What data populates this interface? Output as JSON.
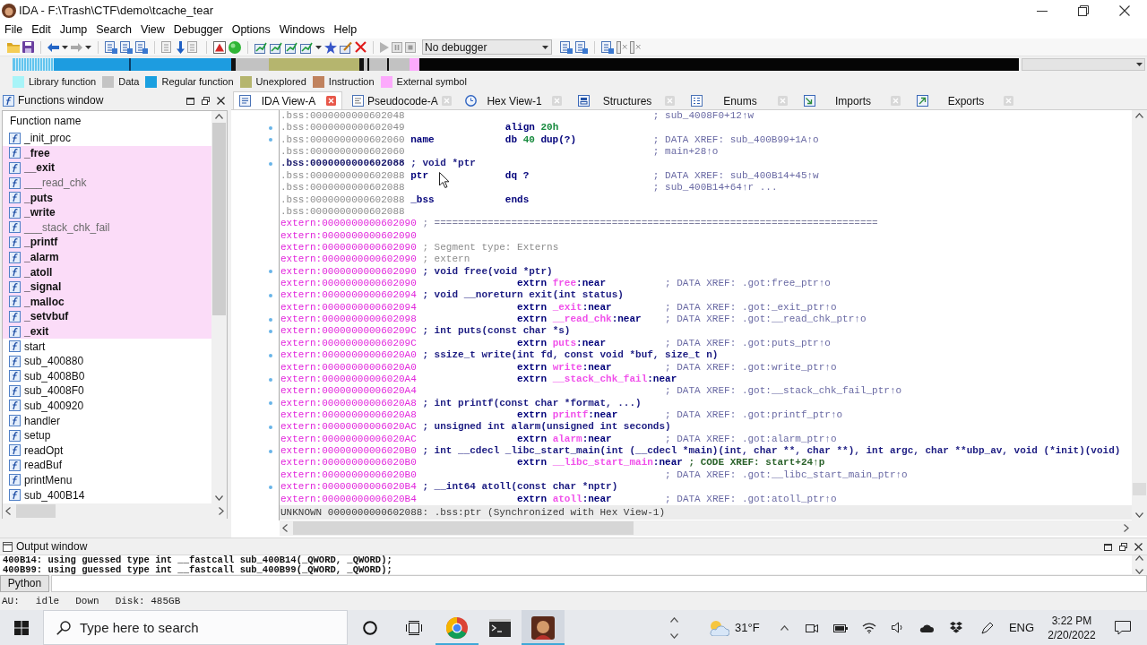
{
  "window": {
    "title": "IDA - F:\\Trash\\CTF\\demo\\tcache_tear"
  },
  "menu": [
    "File",
    "Edit",
    "Jump",
    "Search",
    "View",
    "Debugger",
    "Options",
    "Windows",
    "Help"
  ],
  "toolbar": {
    "debugger": "No debugger"
  },
  "legend": [
    {
      "label": "Library function",
      "color": "#a8f4f8"
    },
    {
      "label": "Data",
      "color": "#c4c4c4"
    },
    {
      "label": "Regular function",
      "color": "#1aa0e0"
    },
    {
      "label": "Unexplored",
      "color": "#b5b56e"
    },
    {
      "label": "Instruction",
      "color": "#c0825e"
    },
    {
      "label": "External symbol",
      "color": "#fcaafc"
    }
  ],
  "functions_window": {
    "title": "Functions window",
    "column": "Function name",
    "items": [
      {
        "name": "_init_proc",
        "external": false,
        "dimmed": false
      },
      {
        "name": "_free",
        "external": true,
        "dimmed": false
      },
      {
        "name": "__exit",
        "external": true,
        "dimmed": false
      },
      {
        "name": "___read_chk",
        "external": true,
        "dimmed": true
      },
      {
        "name": "_puts",
        "external": true,
        "dimmed": false
      },
      {
        "name": "_write",
        "external": true,
        "dimmed": false
      },
      {
        "name": "___stack_chk_fail",
        "external": true,
        "dimmed": true
      },
      {
        "name": "_printf",
        "external": true,
        "dimmed": false
      },
      {
        "name": "_alarm",
        "external": true,
        "dimmed": false
      },
      {
        "name": "_atoll",
        "external": true,
        "dimmed": false
      },
      {
        "name": "_signal",
        "external": true,
        "dimmed": false
      },
      {
        "name": "_malloc",
        "external": true,
        "dimmed": false
      },
      {
        "name": "_setvbuf",
        "external": true,
        "dimmed": false
      },
      {
        "name": "_exit",
        "external": true,
        "dimmed": false
      },
      {
        "name": "start",
        "external": false,
        "dimmed": false
      },
      {
        "name": "sub_400880",
        "external": false,
        "dimmed": false
      },
      {
        "name": "sub_4008B0",
        "external": false,
        "dimmed": false
      },
      {
        "name": "sub_4008F0",
        "external": false,
        "dimmed": false
      },
      {
        "name": "sub_400920",
        "external": false,
        "dimmed": false
      },
      {
        "name": "handler",
        "external": false,
        "dimmed": false
      },
      {
        "name": "setup",
        "external": false,
        "dimmed": false
      },
      {
        "name": "readOpt",
        "external": false,
        "dimmed": false
      },
      {
        "name": "readBuf",
        "external": false,
        "dimmed": false
      },
      {
        "name": "printMenu",
        "external": false,
        "dimmed": false
      },
      {
        "name": "sub_400B14",
        "external": false,
        "dimmed": false
      }
    ]
  },
  "tabs": [
    {
      "label": "IDA View-A",
      "kind": "disassembly",
      "selected": true
    },
    {
      "label": "Pseudocode-A",
      "kind": "pseudocode",
      "selected": false
    },
    {
      "label": "Hex View-1",
      "kind": "hex",
      "selected": false
    },
    {
      "label": "Structures",
      "kind": "structures",
      "selected": false
    },
    {
      "label": "Enums",
      "kind": "enums",
      "selected": false
    },
    {
      "label": "Imports",
      "kind": "imports",
      "selected": false
    },
    {
      "label": "Exports",
      "kind": "exports",
      "selected": false
    }
  ],
  "disassembly": {
    "lines": [
      {
        "kind": "bss",
        "address": ".bss:0000000000602048",
        "dot": false,
        "current": false,
        "parts": [
          {
            "kind": "comment",
            "text": "; sub_4008F0+12↑w"
          }
        ]
      },
      {
        "kind": "bss",
        "address": ".bss:0000000000602049",
        "dot": true,
        "current": false,
        "parts": [
          {
            "kind": "mnemonic",
            "text": "align"
          },
          {
            "kind": "number",
            "text": "20h"
          }
        ]
      },
      {
        "kind": "bss",
        "address": ".bss:0000000000602060",
        "dot": true,
        "current": false,
        "parts": [
          {
            "kind": "label",
            "text": "name"
          },
          {
            "kind": "mnemonic",
            "text": "db"
          },
          {
            "kind": "number",
            "text": "40"
          },
          {
            "kind": "arg",
            "text": "dup(?)"
          },
          {
            "kind": "comment",
            "text": "; DATA XREF: sub_400B99+1A↑o"
          }
        ]
      },
      {
        "kind": "bss",
        "address": ".bss:0000000000602060",
        "dot": false,
        "current": false,
        "parts": [
          {
            "kind": "comment",
            "text": "; main+28↑o"
          }
        ]
      },
      {
        "kind": "bss",
        "address": ".bss:0000000000602088",
        "dot": true,
        "current": true,
        "parts": [
          {
            "kind": "decl",
            "text": "; void *ptr"
          }
        ]
      },
      {
        "kind": "bss",
        "address": ".bss:0000000000602088",
        "dot": false,
        "current": false,
        "parts": [
          {
            "kind": "label",
            "text": "ptr"
          },
          {
            "kind": "mnemonic",
            "text": "dq"
          },
          {
            "kind": "arg",
            "text": "?"
          },
          {
            "kind": "comment",
            "text": "; DATA XREF: sub_400B14+45↑w"
          }
        ]
      },
      {
        "kind": "bss",
        "address": ".bss:0000000000602088",
        "dot": false,
        "current": false,
        "parts": [
          {
            "kind": "comment",
            "text": "; sub_400B14+64↑r ..."
          }
        ]
      },
      {
        "kind": "bss",
        "address": ".bss:0000000000602088",
        "dot": false,
        "current": false,
        "parts": [
          {
            "kind": "label",
            "text": "_bss"
          },
          {
            "kind": "mnemonic",
            "text": "ends"
          }
        ]
      },
      {
        "kind": "bss",
        "address": ".bss:0000000000602088",
        "dot": false,
        "current": false
      },
      {
        "kind": "extern",
        "address": "extern:0000000000602090",
        "dot": false,
        "current": false,
        "parts": [
          {
            "kind": "separator",
            "text": "; ==========================================================================="
          }
        ]
      },
      {
        "kind": "extern",
        "address": "extern:0000000000602090",
        "dot": false,
        "current": false
      },
      {
        "kind": "extern",
        "address": "extern:0000000000602090",
        "dot": false,
        "current": false,
        "parts": [
          {
            "kind": "note",
            "text": "; Segment type: Externs"
          }
        ]
      },
      {
        "kind": "extern",
        "address": "extern:0000000000602090",
        "dot": false,
        "current": false,
        "parts": [
          {
            "kind": "note",
            "text": "; extern"
          }
        ]
      },
      {
        "kind": "extern",
        "address": "extern:0000000000602090",
        "dot": true,
        "current": false,
        "parts": [
          {
            "kind": "decl",
            "text": "; void free(void *ptr)"
          }
        ]
      },
      {
        "kind": "extern",
        "address": "extern:0000000000602090",
        "dot": false,
        "current": false,
        "parts": [
          {
            "kind": "mnemonic",
            "text": "extrn"
          },
          {
            "kind": "import",
            "text": "free"
          },
          {
            "kind": "suffix",
            "text": ":near"
          },
          {
            "kind": "comment",
            "text": "; DATA XREF: .got:free_ptr↑o"
          }
        ]
      },
      {
        "kind": "extern",
        "address": "extern:0000000000602094",
        "dot": true,
        "current": false,
        "parts": [
          {
            "kind": "decl",
            "text": "; void __noreturn exit(int status)"
          }
        ]
      },
      {
        "kind": "extern",
        "address": "extern:0000000000602094",
        "dot": false,
        "current": false,
        "parts": [
          {
            "kind": "mnemonic",
            "text": "extrn"
          },
          {
            "kind": "import",
            "text": "_exit"
          },
          {
            "kind": "suffix",
            "text": ":near"
          },
          {
            "kind": "comment",
            "text": "; DATA XREF: .got:_exit_ptr↑o"
          }
        ]
      },
      {
        "kind": "extern",
        "address": "extern:0000000000602098",
        "dot": true,
        "current": false,
        "parts": [
          {
            "kind": "mnemonic",
            "text": "extrn"
          },
          {
            "kind": "import",
            "text": "__read_chk"
          },
          {
            "kind": "suffix",
            "text": ":near"
          },
          {
            "kind": "comment",
            "text": "; DATA XREF: .got:__read_chk_ptr↑o"
          }
        ]
      },
      {
        "kind": "extern",
        "address": "extern:000000000060209C",
        "dot": true,
        "current": false,
        "parts": [
          {
            "kind": "decl",
            "text": "; int puts(const char *s)"
          }
        ]
      },
      {
        "kind": "extern",
        "address": "extern:000000000060209C",
        "dot": false,
        "current": false,
        "parts": [
          {
            "kind": "mnemonic",
            "text": "extrn"
          },
          {
            "kind": "import",
            "text": "puts"
          },
          {
            "kind": "suffix",
            "text": ":near"
          },
          {
            "kind": "comment",
            "text": "; DATA XREF: .got:puts_ptr↑o"
          }
        ]
      },
      {
        "kind": "extern",
        "address": "extern:00000000006020A0",
        "dot": true,
        "current": false,
        "parts": [
          {
            "kind": "decl",
            "text": "; ssize_t write(int fd, const void *buf, size_t n)"
          }
        ]
      },
      {
        "kind": "extern",
        "address": "extern:00000000006020A0",
        "dot": false,
        "current": false,
        "parts": [
          {
            "kind": "mnemonic",
            "text": "extrn"
          },
          {
            "kind": "import",
            "text": "write"
          },
          {
            "kind": "suffix",
            "text": ":near"
          },
          {
            "kind": "comment",
            "text": "; DATA XREF: .got:write_ptr↑o"
          }
        ]
      },
      {
        "kind": "extern",
        "address": "extern:00000000006020A4",
        "dot": true,
        "current": false,
        "parts": [
          {
            "kind": "mnemonic",
            "text": "extrn"
          },
          {
            "kind": "import",
            "text": "__stack_chk_fail"
          },
          {
            "kind": "suffix",
            "text": ":near"
          }
        ]
      },
      {
        "kind": "extern",
        "address": "extern:00000000006020A4",
        "dot": false,
        "current": false,
        "parts": [
          {
            "kind": "comment",
            "text": "; DATA XREF: .got:__stack_chk_fail_ptr↑o"
          }
        ]
      },
      {
        "kind": "extern",
        "address": "extern:00000000006020A8",
        "dot": true,
        "current": false,
        "parts": [
          {
            "kind": "decl",
            "text": "; int printf(const char *format, ...)"
          }
        ]
      },
      {
        "kind": "extern",
        "address": "extern:00000000006020A8",
        "dot": false,
        "current": false,
        "parts": [
          {
            "kind": "mnemonic",
            "text": "extrn"
          },
          {
            "kind": "import",
            "text": "printf"
          },
          {
            "kind": "suffix",
            "text": ":near"
          },
          {
            "kind": "comment",
            "text": "; DATA XREF: .got:printf_ptr↑o"
          }
        ]
      },
      {
        "kind": "extern",
        "address": "extern:00000000006020AC",
        "dot": true,
        "current": false,
        "parts": [
          {
            "kind": "decl",
            "text": "; unsigned int alarm(unsigned int seconds)"
          }
        ]
      },
      {
        "kind": "extern",
        "address": "extern:00000000006020AC",
        "dot": false,
        "current": false,
        "parts": [
          {
            "kind": "mnemonic",
            "text": "extrn"
          },
          {
            "kind": "import",
            "text": "alarm"
          },
          {
            "kind": "suffix",
            "text": ":near"
          },
          {
            "kind": "comment",
            "text": "; DATA XREF: .got:alarm_ptr↑o"
          }
        ]
      },
      {
        "kind": "extern",
        "address": "extern:00000000006020B0",
        "dot": true,
        "current": false,
        "parts": [
          {
            "kind": "decl",
            "text": "; int __cdecl _libc_start_main(int (__cdecl *main)(int, char **, char **), int argc, char **ubp_av, void (*init)(void)"
          }
        ]
      },
      {
        "kind": "extern",
        "address": "extern:00000000006020B0",
        "dot": false,
        "current": false,
        "parts": [
          {
            "kind": "mnemonic",
            "text": "extrn"
          },
          {
            "kind": "import",
            "text": "__libc_start_main"
          },
          {
            "kind": "suffix",
            "text": ":near"
          },
          {
            "kind": "code_xref",
            "text": "; CODE XREF: start+24↑p"
          }
        ]
      },
      {
        "kind": "extern",
        "address": "extern:00000000006020B0",
        "dot": false,
        "current": false,
        "parts": [
          {
            "kind": "comment",
            "text": "; DATA XREF: .got:__libc_start_main_ptr↑o"
          }
        ]
      },
      {
        "kind": "extern",
        "address": "extern:00000000006020B4",
        "dot": true,
        "current": false,
        "parts": [
          {
            "kind": "decl",
            "text": "; __int64 atoll(const char *nptr)"
          }
        ]
      },
      {
        "kind": "extern",
        "address": "extern:00000000006020B4",
        "dot": false,
        "current": false,
        "parts": [
          {
            "kind": "mnemonic",
            "text": "extrn"
          },
          {
            "kind": "import",
            "text": "atoll"
          },
          {
            "kind": "suffix",
            "text": ":near"
          },
          {
            "kind": "comment",
            "text": "; DATA XREF: .got:atoll_ptr↑o"
          }
        ]
      }
    ],
    "status": "UNKNOWN 0000000000602088: .bss:ptr (Synchronized with Hex View-1)"
  },
  "output_window": {
    "title": "Output window",
    "lines": [
      "400B14: using guessed type int __fastcall sub_400B14(_QWORD, _QWORD);",
      "400B99: using guessed type int __fastcall sub_400B99(_QWORD, _QWORD);"
    ]
  },
  "command_line": {
    "language": "Python"
  },
  "status_bar": [
    "AU:",
    "idle",
    "Down",
    "Disk: 485GB"
  ],
  "taskbar": {
    "search_placeholder": "Type here to search",
    "apps": [
      {
        "kind": "browser",
        "running": true,
        "active": false
      },
      {
        "kind": "terminal",
        "running": false,
        "active": false
      },
      {
        "kind": "disassembler",
        "running": true,
        "active": true
      }
    ],
    "weather": "31°F",
    "language": "ENG",
    "time": "3:22 PM",
    "date": "2/20/2022"
  }
}
